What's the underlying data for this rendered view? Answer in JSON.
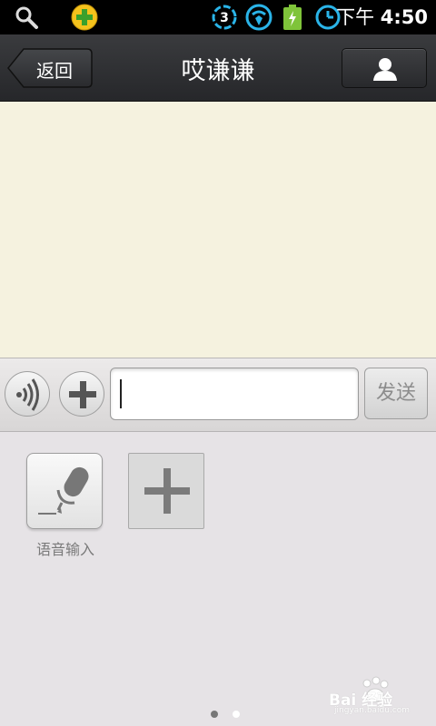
{
  "status_bar": {
    "notification_icons": [
      "search-icon",
      "plus-app-icon"
    ],
    "system_icons": [
      "sync-3-icon",
      "wifi-icon",
      "battery-charging-icon",
      "clock-icon"
    ],
    "sync_count": "3",
    "time_period": "下午",
    "time": "4:50"
  },
  "header": {
    "back_label": "返回",
    "title": "哎谦谦",
    "profile_icon": "person-icon"
  },
  "input_bar": {
    "voice_icon": "sound-wave-icon",
    "plus_icon": "plus-icon",
    "message_value": "",
    "send_label": "发送"
  },
  "panel": {
    "tiles": [
      {
        "icon": "microphone-icon",
        "label": "语音输入"
      },
      {
        "icon": "plus-icon",
        "label": ""
      }
    ],
    "page_indicator": {
      "count": 2,
      "current": 1
    }
  },
  "watermark": {
    "text": "Bai  经验",
    "sub": "jingyan.baidu.com"
  },
  "colors": {
    "titlebar": "#2f3033",
    "chat_background": "#f5f2df",
    "panel_background": "#e6e3e6",
    "accent_blue": "#2ab4e8"
  }
}
